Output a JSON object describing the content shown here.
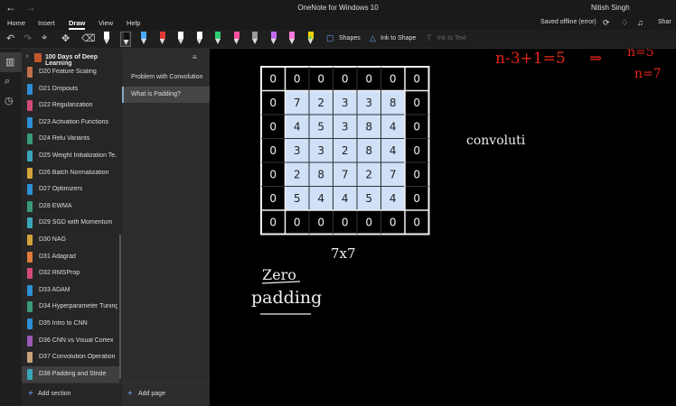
{
  "app": {
    "title": "OneNote for Windows 10",
    "user": "Nitish Singh",
    "status": "Saved offline (error)",
    "share_label": "Shar"
  },
  "menu": {
    "tabs": [
      "Home",
      "Insert",
      "Draw",
      "View",
      "Help"
    ],
    "active_tab": "Draw"
  },
  "ribbon": {
    "shapes_label": "Shapes",
    "ink_to_shape_label": "Ink to Shape",
    "ink_to_text_label": "Ink to Text",
    "pens": [
      {
        "color": "#ffffff",
        "selected": false
      },
      {
        "color": "#111111",
        "selected": true
      },
      {
        "color": "#4aa8ff",
        "selected": false
      },
      {
        "color": "#e53935",
        "selected": false
      },
      {
        "color": "#ffffff",
        "selected": false
      },
      {
        "color": "#ffffff",
        "selected": false
      },
      {
        "color": "#2ecc71",
        "selected": false
      },
      {
        "color": "#ff4fa3",
        "selected": false
      },
      {
        "color": "#9a9a9a",
        "selected": false
      },
      {
        "color": "#c06cf0",
        "selected": false
      },
      {
        "color": "#ff7ad9",
        "selected": false
      },
      {
        "color": "#ffd400",
        "selected": false
      }
    ]
  },
  "notebook": {
    "name": "100 Days of Deep Learning",
    "color": "#c2572d"
  },
  "sections": [
    {
      "label": "D20 Feature Scaling",
      "color": "#c0704a"
    },
    {
      "label": "D21 Dropouts",
      "color": "#2e8fd6"
    },
    {
      "label": "D22 Regularization",
      "color": "#d24a7a"
    },
    {
      "label": "D23 Activation Functions",
      "color": "#2e8fd6"
    },
    {
      "label": "D24 Relu Variants",
      "color": "#3a9a7a"
    },
    {
      "label": "D25 Weight Initialization Te...",
      "color": "#3aa6b9"
    },
    {
      "label": "D26 Batch Normalization",
      "color": "#d4a13a"
    },
    {
      "label": "D27 Optimizers",
      "color": "#2e8fd6"
    },
    {
      "label": "D28 EWMA",
      "color": "#3a9a7a"
    },
    {
      "label": "D29 SGD with Momentum",
      "color": "#3aa6b9"
    },
    {
      "label": "D30 NAG",
      "color": "#d4a13a"
    },
    {
      "label": "D31 Adagrad",
      "color": "#e07b3c"
    },
    {
      "label": "D32 RMSProp",
      "color": "#d24a7a"
    },
    {
      "label": "D33 ADAM",
      "color": "#2e8fd6"
    },
    {
      "label": "D34 Hyperparameter Tuning",
      "color": "#3a9a7a"
    },
    {
      "label": "D35 Intro to CNN",
      "color": "#2e8fd6"
    },
    {
      "label": "D36 CNN vs Visual Cortex",
      "color": "#9b59b6"
    },
    {
      "label": "D37 Convolution Operation",
      "color": "#c9a27a"
    },
    {
      "label": "D38 Padding and Stride",
      "color": "#3aa6b9"
    }
  ],
  "active_section": "D38 Padding and Stride",
  "add_section_label": "Add section",
  "pages": [
    {
      "label": "Problem with Convolution"
    },
    {
      "label": "What is Padding?"
    }
  ],
  "active_page": "What is Padding?",
  "add_page_label": "Add page",
  "note": {
    "grid_outer_zero": "0",
    "inner_grid": [
      [
        7,
        2,
        3,
        3,
        8
      ],
      [
        4,
        5,
        3,
        8,
        4
      ],
      [
        3,
        3,
        2,
        8,
        4
      ],
      [
        2,
        8,
        7,
        2,
        7
      ],
      [
        5,
        4,
        4,
        5,
        4
      ]
    ],
    "size_label": "7x7",
    "zero_label": "Zero",
    "padding_label": "padding",
    "convolution_label": "convoluti",
    "red_formula": "n-3+1=5",
    "red_arrow": "⇒",
    "red_n1": "n=5",
    "red_n2": "n=7"
  }
}
